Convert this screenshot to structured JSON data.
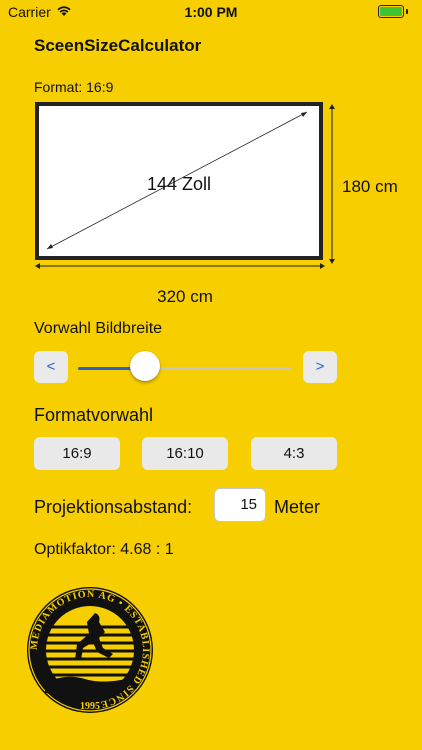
{
  "status_bar": {
    "carrier": "Carrier",
    "time": "1:00 PM"
  },
  "app": {
    "title": "SceenSizeCalculator"
  },
  "format": {
    "label": "Format: 16:9"
  },
  "screen": {
    "diagonal": "144 Zoll",
    "height": "180 cm",
    "width": "320 cm"
  },
  "width_preset": {
    "label": "Vorwahl Bildbreite",
    "decrement": "<",
    "increment": ">",
    "slider_fraction": 0.3
  },
  "format_preset": {
    "label": "Formatvorwahl",
    "options": [
      "16:9",
      "16:10",
      "4:3"
    ]
  },
  "distance": {
    "label": "Projektionsabstand:",
    "value": "15",
    "unit": "Meter"
  },
  "optics": {
    "label": "Optikfaktor: 4.68 : 1"
  },
  "logo": {
    "ring_top": "MEDIAMOTION AG • ESTABLISHED SINCE",
    "year": "1995"
  },
  "colors": {
    "background": "#f7cf00",
    "accent": "#2a62c9",
    "frame": "#222222",
    "battery": "#3ec433"
  }
}
